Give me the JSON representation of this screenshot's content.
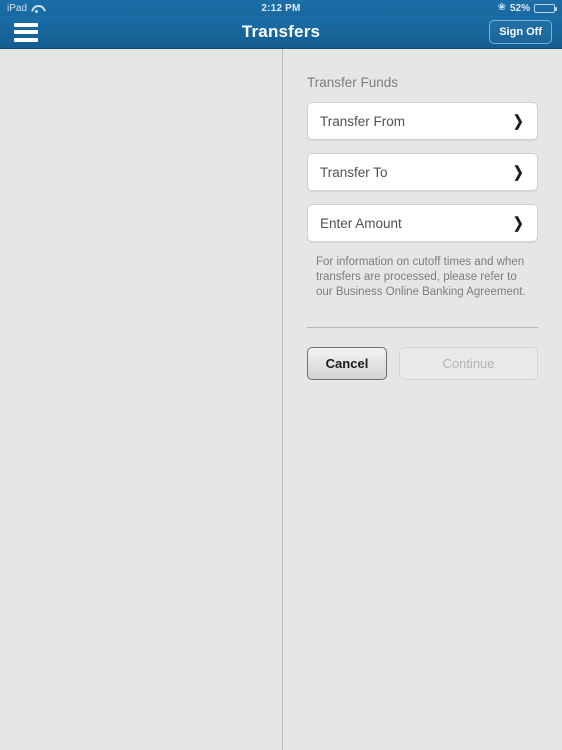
{
  "status_bar": {
    "device": "iPad",
    "wifi_icon": "wifi-icon",
    "time": "2:12 PM",
    "bluetooth_icon": "bluetooth-icon",
    "battery_percent": "52%",
    "battery_level": 52
  },
  "nav_bar": {
    "menu_icon": "hamburger-menu-icon",
    "title": "Transfers",
    "sign_off_label": "Sign Off"
  },
  "main": {
    "section_title": "Transfer Funds",
    "fields": [
      {
        "label": "Transfer From",
        "chevron": "❯"
      },
      {
        "label": "Transfer To",
        "chevron": "❯"
      },
      {
        "label": "Enter Amount",
        "chevron": "❯"
      }
    ],
    "info_text": "For information on cutoff times and when transfers are processed, please refer to our Business Online Banking Agreement.",
    "buttons": {
      "cancel_label": "Cancel",
      "continue_label": "Continue"
    }
  },
  "colors": {
    "nav_blue": "#1b6ea8",
    "background_grey": "#e6e6e6",
    "field_white": "#ffffff",
    "disabled_text": "#b4b4b4"
  }
}
